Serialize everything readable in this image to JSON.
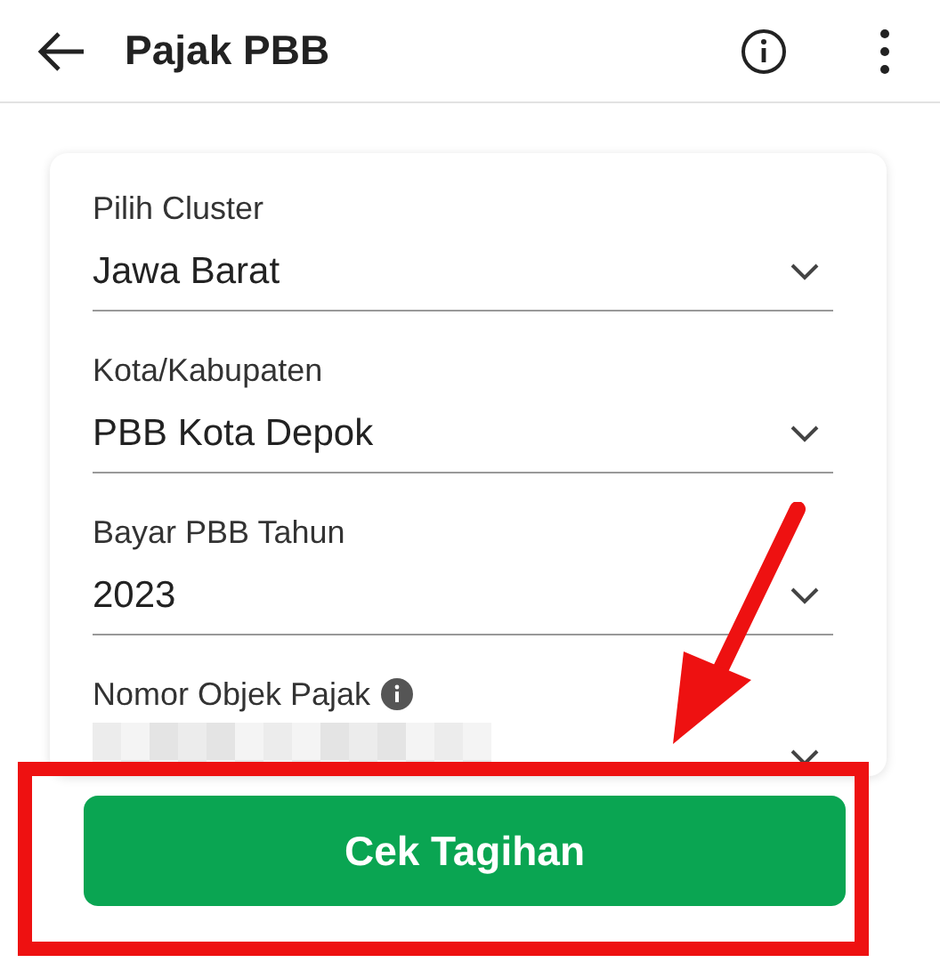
{
  "header": {
    "title": "Pajak PBB"
  },
  "fields": [
    {
      "label": "Pilih Cluster",
      "value": "Jawa Barat",
      "info": false,
      "redacted": false
    },
    {
      "label": "Kota/Kabupaten",
      "value": "PBB Kota Depok",
      "info": false,
      "redacted": false
    },
    {
      "label": "Bayar PBB Tahun",
      "value": "2023",
      "info": false,
      "redacted": false
    },
    {
      "label": "Nomor Objek Pajak",
      "info": true,
      "redacted": true
    }
  ],
  "submit_button": {
    "label": "Cek Tagihan"
  },
  "annotations": {
    "arrow": true,
    "highlight_frame": true
  }
}
